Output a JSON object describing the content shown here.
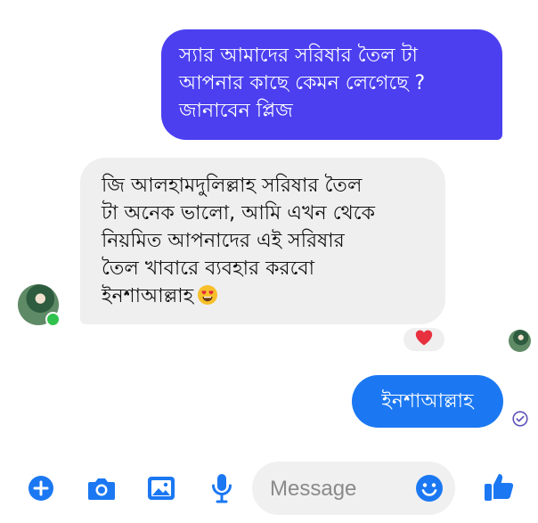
{
  "colors": {
    "outgoing_purple": "#4b3ff0",
    "outgoing_blue": "#1b78f2",
    "incoming_gray": "#efefef",
    "accent": "#1b78f2",
    "online": "#31c24d",
    "reaction_heart": "#e8313f"
  },
  "conversation": {
    "messages": [
      {
        "sender": "me",
        "lines": [
          "স্যার আমাদের সরিষার তৈল টা",
          "আপনার কাছে কেমন লেগেছে ?",
          "জানাবেন প্লিজ"
        ]
      },
      {
        "sender": "contact",
        "lines": [
          "জি আলহামদুলিল্লাহ সরিষার  তৈল",
          "টা অনেক ভালো, আমি এখন থেকে",
          "নিয়মিত আপনাদের এই সরিষার",
          "তৈল খাবারে ব্যবহার করবো",
          "ইনশাআল্লাহ"
        ],
        "emoji_icon": "heart-eyes-emoji-icon",
        "reaction_icon": "red-heart-icon"
      },
      {
        "sender": "me",
        "lines": [
          "ইনশাআল্লাহ"
        ],
        "status_icon": "delivered-check-icon"
      }
    ]
  },
  "composer": {
    "placeholder": "Message",
    "icons": [
      "plus-circle-icon",
      "camera-icon",
      "gallery-icon",
      "microphone-icon",
      "smiley-icon",
      "thumbs-up-icon"
    ]
  }
}
